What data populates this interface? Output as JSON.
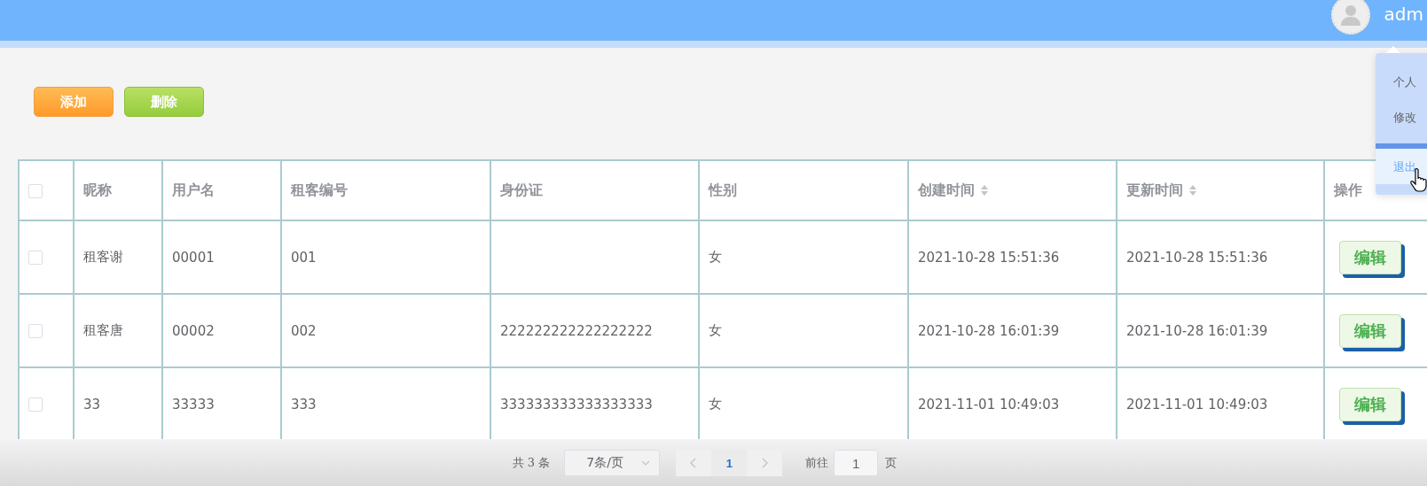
{
  "header": {
    "user": "adm"
  },
  "user_menu": {
    "items": [
      {
        "label": "个人",
        "selected": false
      },
      {
        "label": "修改",
        "selected": false
      },
      {
        "label": "退出",
        "selected": true
      }
    ]
  },
  "toolbar": {
    "buttons": [
      {
        "label": "添加",
        "kind": "add"
      },
      {
        "label": "删除",
        "kind": "delete"
      }
    ]
  },
  "table": {
    "select_all": {
      "checked": false
    },
    "columns": [
      {
        "label": "昵称",
        "sortable": false
      },
      {
        "label": "用户名",
        "sortable": false
      },
      {
        "label": "租客编号",
        "sortable": false
      },
      {
        "label": "身份证",
        "sortable": false
      },
      {
        "label": "性别",
        "sortable": false
      },
      {
        "label": "创建时间",
        "sortable": true
      },
      {
        "label": "更新时间",
        "sortable": true
      },
      {
        "label": "操作",
        "sortable": false
      }
    ],
    "rows": [
      {
        "checked": false,
        "cells": [
          "租客谢",
          "00001",
          "001",
          null,
          "女",
          "2021-10-28 15:51:36",
          "2021-10-28 15:51:36"
        ],
        "action": "编辑"
      },
      {
        "checked": false,
        "cells": [
          "租客唐",
          "00002",
          "002",
          "222222222222222222",
          "女",
          "2021-10-28 16:01:39",
          "2021-10-28 16:01:39"
        ],
        "action": "编辑"
      },
      {
        "checked": false,
        "cells": [
          "33",
          "33333",
          "333",
          "333333333333333333",
          "女",
          "2021-11-01 10:49:03",
          "2021-11-01 10:49:03"
        ],
        "action": "编辑"
      }
    ]
  },
  "pagination": {
    "total": "共 3 条",
    "page_size": "7条/页",
    "pages": [
      {
        "label": "1",
        "selected": true
      }
    ],
    "goto_label": "前往",
    "goto_value": "1",
    "goto_suffix": "页"
  }
}
